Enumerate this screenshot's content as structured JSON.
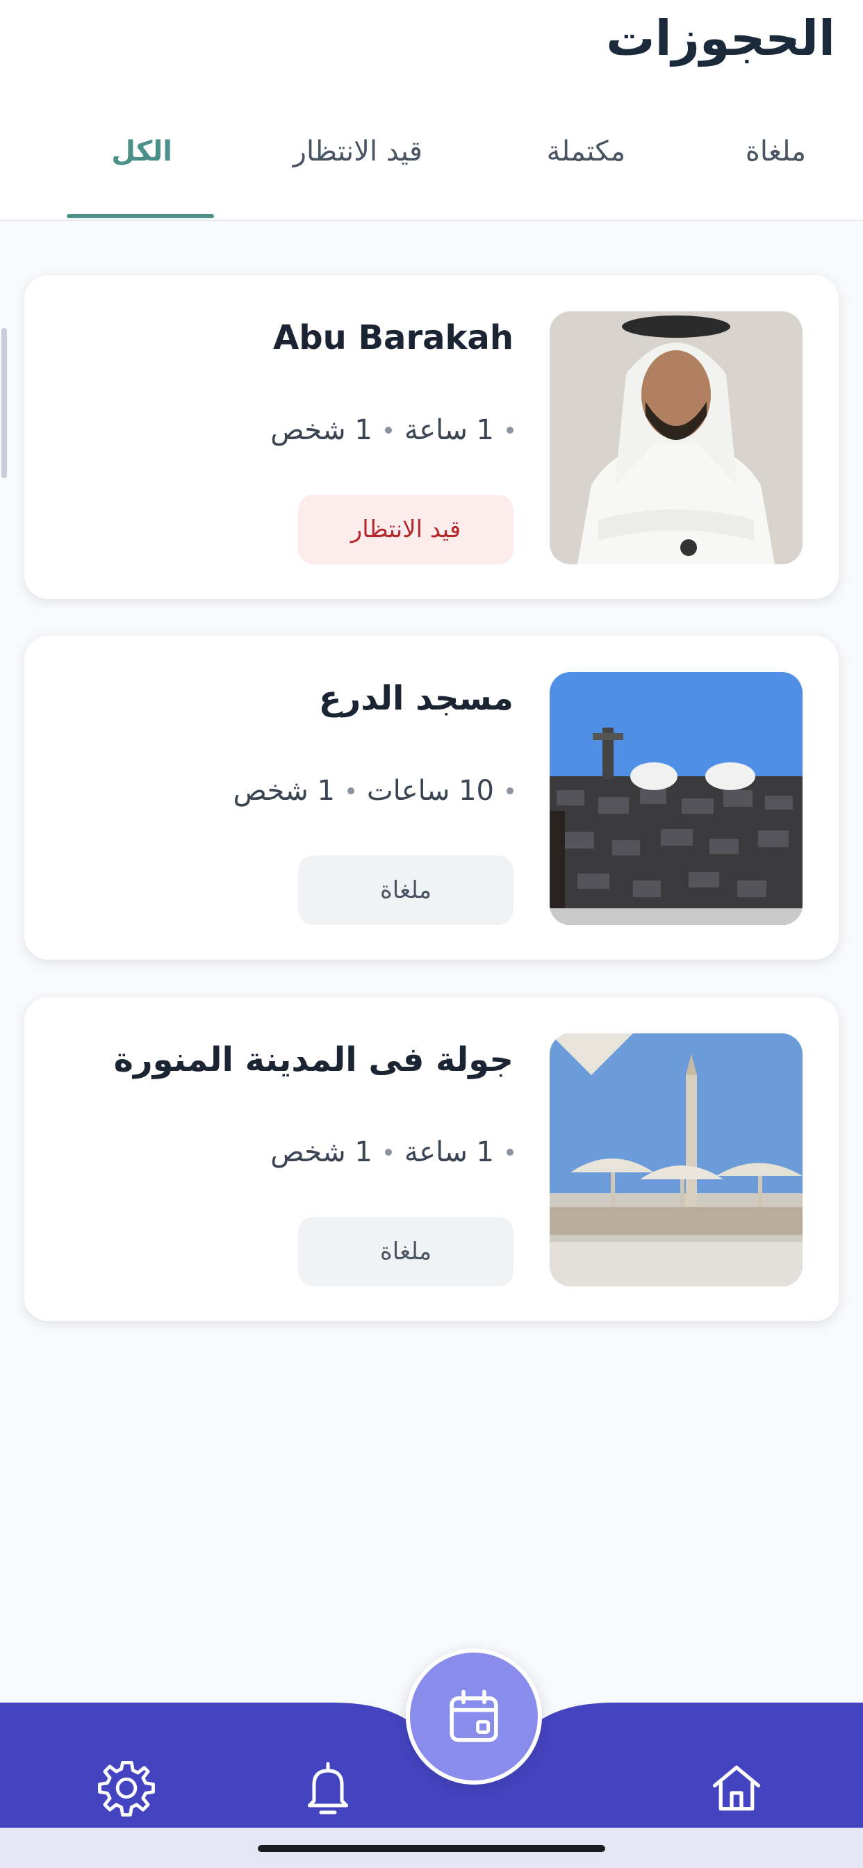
{
  "header": {
    "title": "الحجوزات",
    "tabs": [
      {
        "label": "ملغاة",
        "active": false
      },
      {
        "label": "مكتملة",
        "active": false
      },
      {
        "label": "قيد الانتظار",
        "active": false
      },
      {
        "label": "الكل",
        "active": true
      }
    ]
  },
  "bookings": [
    {
      "title": "Abu Barakah",
      "duration": "1 ساعة",
      "persons": "1 شخص",
      "status": "قيد الانتظار",
      "status_type": "pending",
      "image": "man-in-traditional-dress-photo"
    },
    {
      "title": "مسجد الدرع",
      "duration": "10 ساعات",
      "persons": "1 شخص",
      "status": "ملغاة",
      "status_type": "cancelled",
      "image": "stone-mosque-photo"
    },
    {
      "title": "جولة فى المدينة المنورة",
      "duration": "1 ساعة",
      "persons": "1 شخص",
      "status": "ملغاة",
      "status_type": "cancelled",
      "image": "prophets-mosque-umbrellas-photo"
    }
  ],
  "bottom_nav": {
    "items": [
      {
        "icon": "home-icon"
      },
      {
        "icon": "calendar-icon"
      },
      {
        "icon": "bell-icon"
      },
      {
        "icon": "gear-icon"
      }
    ]
  },
  "colors": {
    "accent": "#4f9089",
    "nav_background": "#4544c0",
    "fab": "#8a8cec",
    "pending_bg": "#fdecec",
    "pending_text": "#b3282d"
  }
}
